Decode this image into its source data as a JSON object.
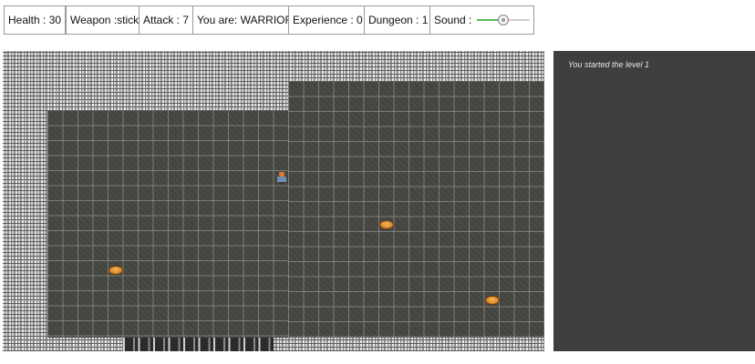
{
  "hud": {
    "health": "Health : 30",
    "weapon": "Weapon :stick",
    "attack": "Attack : 7",
    "role": "You are: WARRIOR",
    "experience": "Experience : 0",
    "dungeon": "Dungeon : 1",
    "sound_label": "Sound :",
    "sound_volume": 0.5
  },
  "map": {
    "player_icon": "warrior-icon",
    "items": [
      "food-icon",
      "food-icon",
      "food-icon"
    ]
  },
  "log": {
    "messages": [
      "You started the level 1"
    ]
  },
  "colors": {
    "floor": "#4a4a45",
    "log_bg": "#3e3e3e",
    "slider_fill": "#5cb85c"
  }
}
